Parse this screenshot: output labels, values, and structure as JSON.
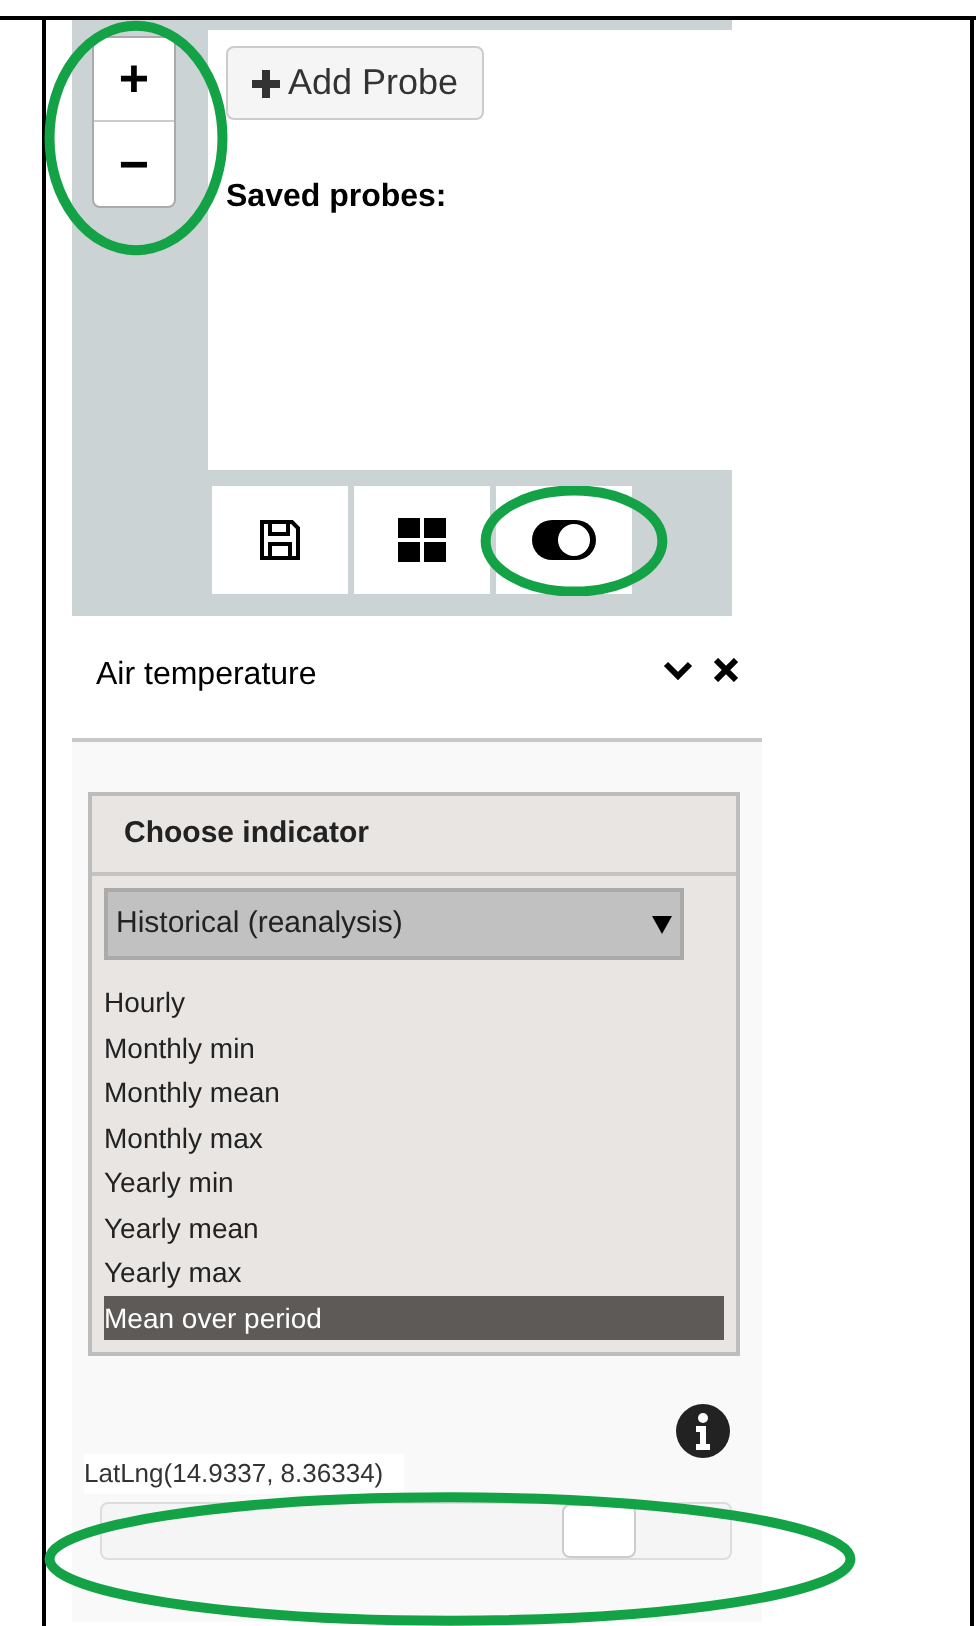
{
  "map_panel": {
    "zoom_in": "+",
    "zoom_out": "−",
    "add_probe_button": "Add Probe",
    "saved_probes_label": "Saved probes:"
  },
  "panel": {
    "title": "Air temperature"
  },
  "indicator": {
    "heading": "Choose indicator",
    "dropdown_value": "Historical (reanalysis)",
    "options": [
      {
        "label": "Hourly",
        "selected": false
      },
      {
        "label": "Monthly min",
        "selected": false
      },
      {
        "label": "Monthly mean",
        "selected": false
      },
      {
        "label": "Monthly max",
        "selected": false
      },
      {
        "label": "Yearly min",
        "selected": false
      },
      {
        "label": "Yearly mean",
        "selected": false
      },
      {
        "label": "Yearly max",
        "selected": false
      },
      {
        "label": "Mean over period",
        "selected": true
      }
    ]
  },
  "coordinates": "LatLng(14.9337, 8.36334)",
  "slider": {
    "level": 0.79
  }
}
